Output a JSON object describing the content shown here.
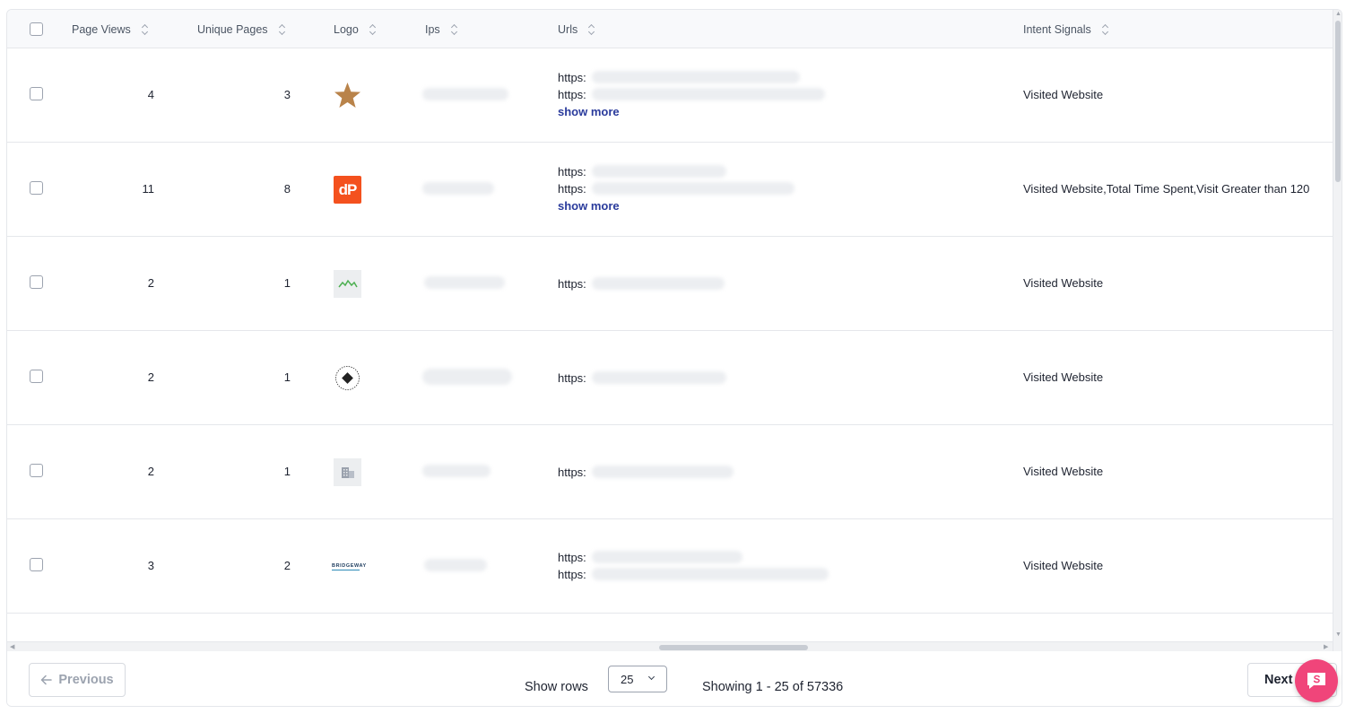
{
  "columns": [
    {
      "key": "page_views",
      "label": "Page Views"
    },
    {
      "key": "unique_pages",
      "label": "Unique Pages"
    },
    {
      "key": "logo",
      "label": "Logo"
    },
    {
      "key": "ips",
      "label": "Ips"
    },
    {
      "key": "urls",
      "label": "Urls"
    },
    {
      "key": "intent_signals",
      "label": "Intent Signals"
    }
  ],
  "rows": [
    {
      "page_views": "4",
      "unique_pages": "3",
      "logo_icon": "star-logo-icon",
      "urls": [
        "https:",
        "https:"
      ],
      "show_more": "show more",
      "intent": "Visited Website"
    },
    {
      "page_views": "11",
      "unique_pages": "8",
      "logo_icon": "dp-logo-icon",
      "logo_text": "dP",
      "urls": [
        "https:",
        "https:"
      ],
      "show_more": "show more",
      "intent": "Visited Website,Total Time Spent,Visit Greater than 120"
    },
    {
      "page_views": "2",
      "unique_pages": "1",
      "logo_icon": "mountain-logo-icon",
      "urls": [
        "https:"
      ],
      "intent": "Visited Website"
    },
    {
      "page_views": "2",
      "unique_pages": "1",
      "logo_icon": "badge-logo-icon",
      "urls": [
        "https:"
      ],
      "intent": "Visited Website"
    },
    {
      "page_views": "2",
      "unique_pages": "1",
      "logo_icon": "building-placeholder-icon",
      "urls": [
        "https:"
      ],
      "intent": "Visited Website"
    },
    {
      "page_views": "3",
      "unique_pages": "2",
      "logo_icon": "bridgeway-logo-icon",
      "logo_text": "BRIDGEWAY",
      "urls": [
        "https:",
        "https:"
      ],
      "intent": "Visited Website"
    }
  ],
  "pagination": {
    "previous_label": "Previous",
    "next_label": "Next",
    "show_rows_label": "Show rows",
    "rows_per_page": "25",
    "showing_text": "Showing 1 - 25 of 57336"
  },
  "colors": {
    "accent_link": "#2a3b9c",
    "chat_button": "#f0457a",
    "dp_logo": "#f4511e"
  }
}
